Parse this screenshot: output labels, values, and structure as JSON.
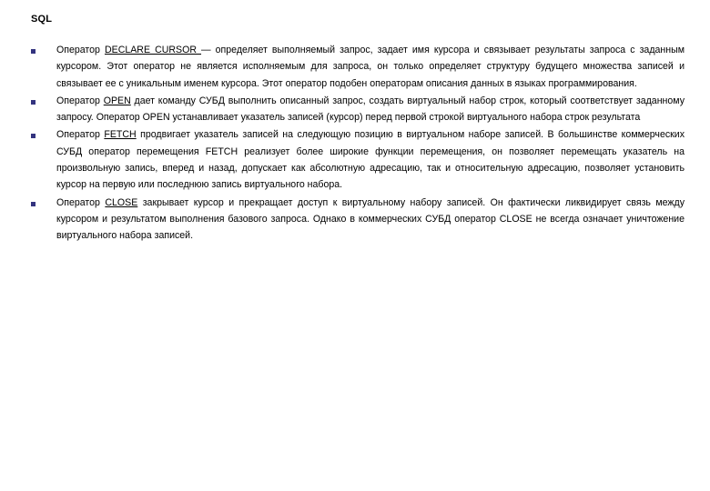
{
  "slide": {
    "title": "SQL",
    "background_color": "#ffffff",
    "text_color": "#000000",
    "bullet_color": "#33337f",
    "bullet_icon": "square-bullet-icon",
    "bullets": [
      {
        "keyword": "DECLARE CURSOR ",
        "lead": "Оператор ",
        "rest": "— определяет выполняемый запрос, задает имя курсора и связывает результаты запроса с заданным курсором. Этот оператор не является исполняемым для запроса, он только определяет структуру будущего множества записей и связывает ее с уникальным именем курсора. Этот оператор подобен операторам описания данных в языках программирования."
      },
      {
        "keyword": "OPEN",
        "lead": "Оператор ",
        "rest": " дает команду СУБД выполнить описанный запрос, создать виртуальный набор строк, который соответствует заданному запросу. Оператор OPEN устанавливает указатель записей (курсор) перед первой строкой виртуального набора строк результата"
      },
      {
        "keyword": "FETCH",
        "lead": "Оператор ",
        "rest": " продвигает указатель записей на следующую позицию в виртуальном наборе записей. В большинстве коммерческих СУБД оператор перемещения FETCH реализует более широкие функции перемещения, он позволяет перемещать указатель на произвольную запись, вперед и назад, допускает как абсолютную адресацию, так и относительную адресацию, позволяет установить курсор на первую или последнюю запись виртуального набора."
      },
      {
        "keyword": "CLOSE",
        "lead": "Оператор ",
        "rest": " закрывает курсор и прекращает доступ к виртуальному набору записей. Он фактически ликвидирует связь между курсором и результатом выполнения базового запроса. Однако в коммерческих СУБД оператор CLOSE не всегда означает уничтожение виртуального набора записей."
      }
    ]
  }
}
